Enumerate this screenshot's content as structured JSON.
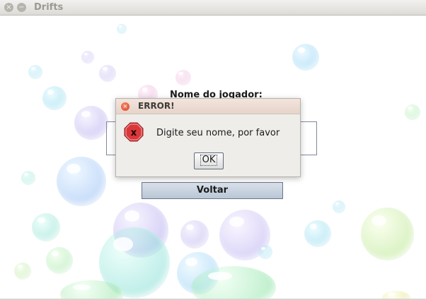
{
  "window": {
    "title": "Drifts",
    "close_glyph": "×",
    "minimize_glyph": "−"
  },
  "form": {
    "player_label": "Nome do jogador:",
    "name_value": "",
    "back_label": "Voltar"
  },
  "dialog": {
    "title": "ERROR!",
    "close_glyph": "×",
    "icon": "error-x-icon",
    "message": "Digite seu nome, por favor",
    "ok_label": "OK"
  },
  "colors": {
    "dialog_title_bg": "#e6d4ca",
    "error_icon": "#d9383a",
    "button_blue": "#bac6d6"
  }
}
